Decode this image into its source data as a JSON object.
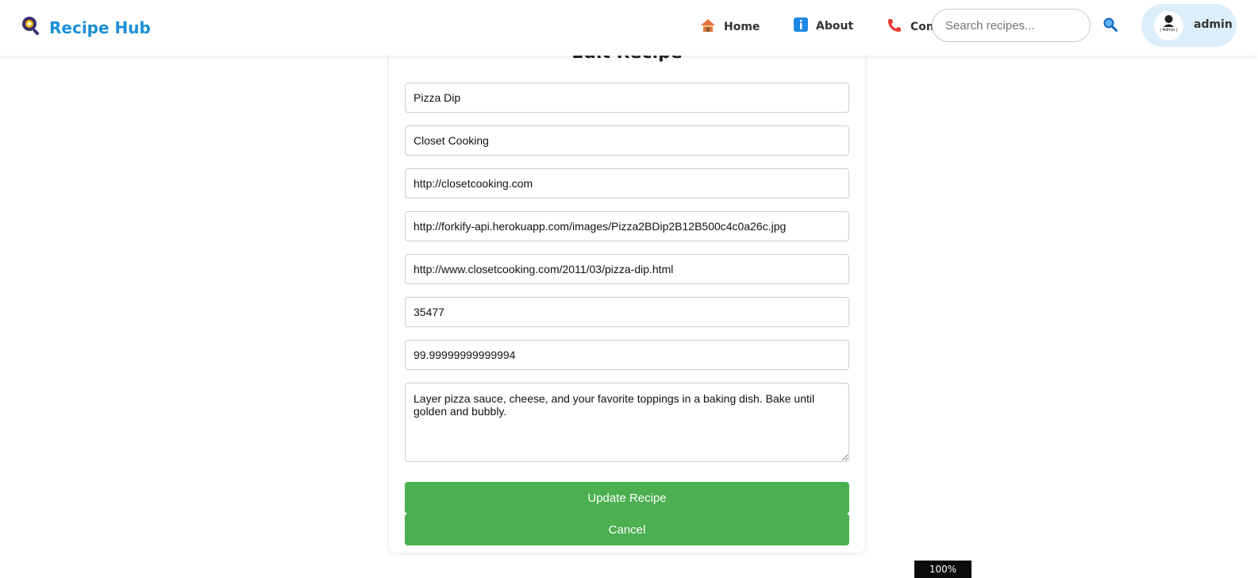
{
  "navbar": {
    "brand": "Recipe Hub",
    "links": [
      {
        "label": "Home",
        "icon": "house-icon"
      },
      {
        "label": "About",
        "icon": "info-icon"
      },
      {
        "label": "Cont",
        "icon": "phone-icon"
      }
    ],
    "search_placeholder": "Search recipes...",
    "user": {
      "name": "admin",
      "avatar_caption": "| Admin |"
    }
  },
  "form": {
    "title": "Edit Recipe",
    "fields": {
      "title": "Pizza Dip",
      "publisher": "Closet Cooking",
      "publisher_url": "http://closetcooking.com",
      "image_url": "http://forkify-api.herokuapp.com/images/Pizza2BDip2B12B500c4c0a26c.jpg",
      "source_url": "http://www.closetcooking.com/2011/03/pizza-dip.html",
      "recipe_id": "35477",
      "social_rank": "99.99999999999994",
      "instructions": "Layer pizza sauce, cheese, and your favorite toppings in a baking dish. Bake until golden and bubbly."
    },
    "update_label": "Update Recipe",
    "cancel_label": "Cancel"
  },
  "zoom": "100%",
  "colors": {
    "accent_green": "#4caf50",
    "brand_blue": "#1a8fd6",
    "user_pill": "#ddeefb"
  }
}
